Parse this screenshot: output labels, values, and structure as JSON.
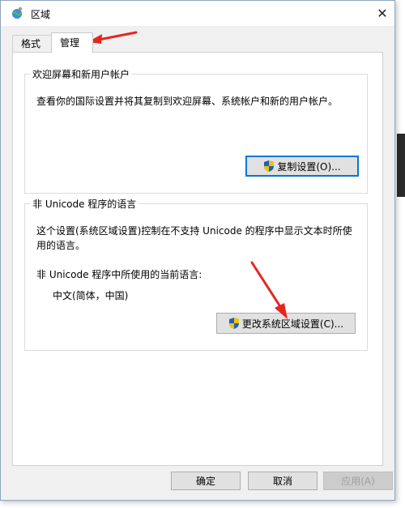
{
  "window": {
    "title": "区域",
    "close_glyph": "✕"
  },
  "tabs": [
    {
      "label": "格式"
    },
    {
      "label": "管理"
    }
  ],
  "welcome_group": {
    "legend": "欢迎屏幕和新用户帐户",
    "description": "查看你的国际设置并将其复制到欢迎屏幕、系统帐户和新的用户帐户。",
    "button_label": "复制设置(O)..."
  },
  "unicode_group": {
    "legend": "非 Unicode 程序的语言",
    "description": "这个设置(系统区域设置)控制在不支持 Unicode 的程序中显示文本时所使用的语言。",
    "current_label": "非 Unicode 程序中所使用的当前语言:",
    "current_value": "中文(简体，中国)",
    "button_label": "更改系统区域设置(C)..."
  },
  "footer": {
    "ok": "确定",
    "cancel": "取消",
    "apply": "应用(A)"
  },
  "colors": {
    "accent": "#0078d7",
    "arrow": "#e5261f",
    "shield_blue": "#1d5fbf",
    "shield_yellow": "#f2c200"
  },
  "icons": {
    "app": "globe-icon",
    "close": "close-icon",
    "shield": "uac-shield-icon"
  }
}
